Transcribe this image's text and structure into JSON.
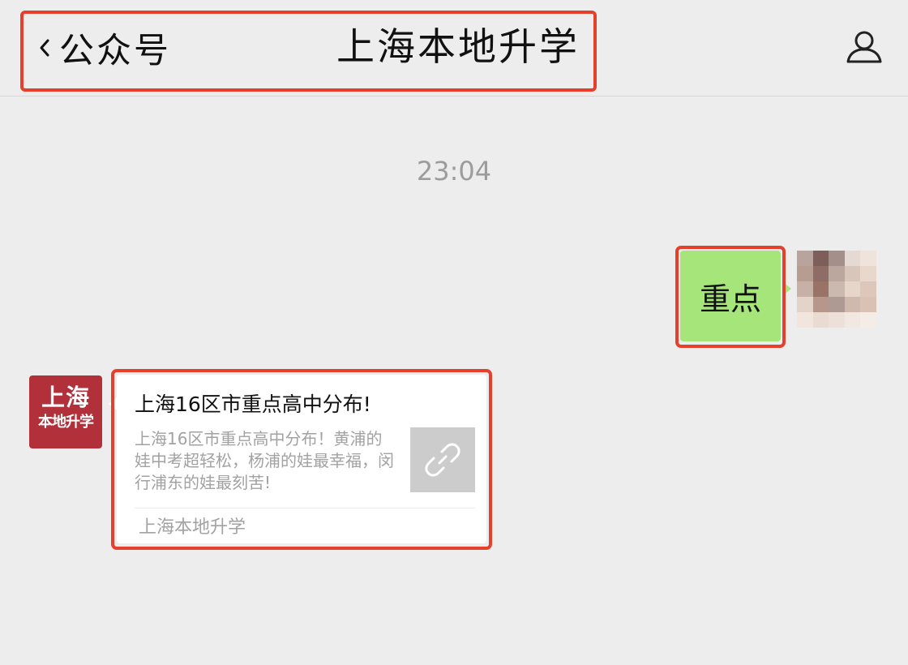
{
  "header": {
    "back_label": "公众号",
    "title": "上海本地升学"
  },
  "chat": {
    "timestamp": "23:04",
    "sent_message": "重点",
    "received_card": {
      "title": "上海16区市重点高中分布!",
      "description": "上海16区市重点高中分布！黄浦的娃中考超轻松，杨浦的娃最幸福，闵行浦东的娃最刻苦!",
      "source": "上海本地升学",
      "thumbnail_icon": "link-icon"
    }
  },
  "account_avatar": {
    "line1": "上海",
    "line2": "本地升学",
    "color": "#B1303A"
  },
  "icons": {
    "back": "chevron-left-icon",
    "profile": "person-icon",
    "thumbnail": "link-icon"
  },
  "colors": {
    "background": "#EDEDED",
    "sent_bubble": "#A5E57A",
    "highlight": "#E5402C",
    "card": "#FFFFFF",
    "muted_text": "#A2A2A2"
  }
}
